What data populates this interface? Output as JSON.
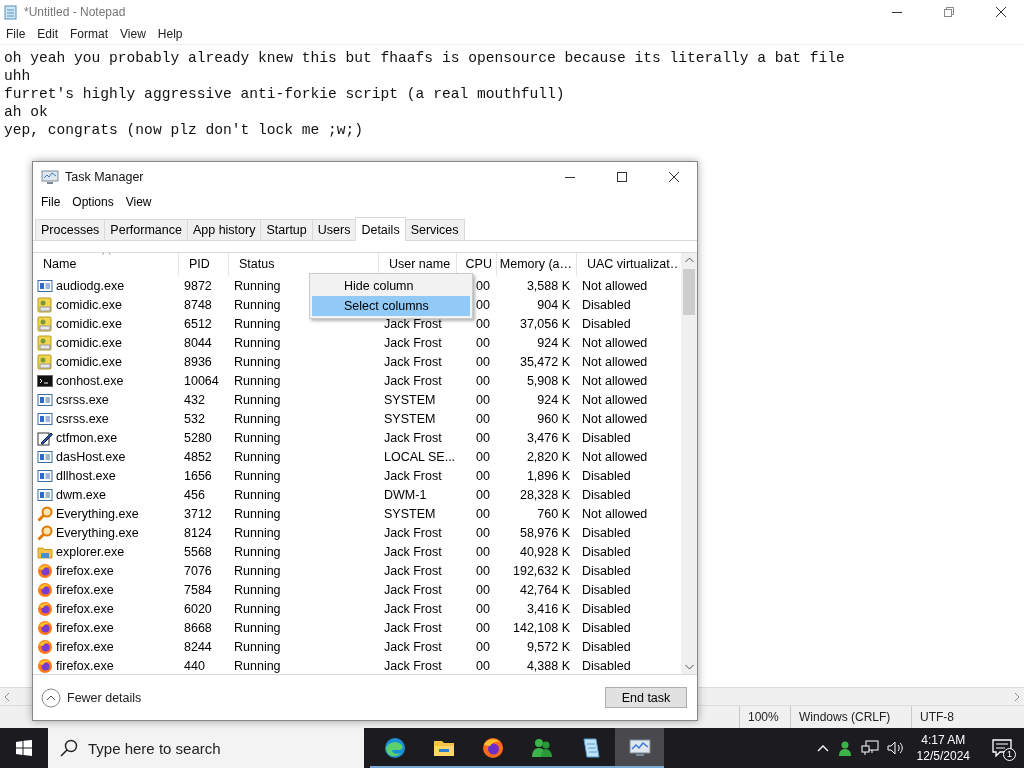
{
  "notepad": {
    "title": "*Untitled - Notepad",
    "menu": [
      "File",
      "Edit",
      "Format",
      "View",
      "Help"
    ],
    "lines": [
      "oh yeah you probably already knew this but fhaafs is opensource because its literally a bat file",
      "uhh",
      "furret's highly aggressive anti-forkie script (a real mouthfull)",
      "ah ok",
      "yep, congrats (now plz don't lock me ;w;)"
    ],
    "status_bar": [
      "100%",
      "Windows (CRLF)",
      "UTF-8"
    ]
  },
  "task_manager": {
    "title": "Task Manager",
    "menu": [
      "File",
      "Options",
      "View"
    ],
    "tabs": [
      {
        "label": "Processes",
        "selected": false
      },
      {
        "label": "Performance",
        "selected": false
      },
      {
        "label": "App history",
        "selected": false
      },
      {
        "label": "Startup",
        "selected": false
      },
      {
        "label": "Users",
        "selected": false
      },
      {
        "label": "Details",
        "selected": true
      },
      {
        "label": "Services",
        "selected": false
      }
    ],
    "columns": [
      "Name",
      "PID",
      "Status",
      "User name",
      "CPU",
      "Memory (a…",
      "UAC virtualizat…"
    ],
    "rows": [
      {
        "kind": "window",
        "name": "audiodg.exe",
        "pid": "9872",
        "status": "Running",
        "cpu": "00",
        "memory": "3,588 K",
        "uac": "Not allowed"
      },
      {
        "kind": "app",
        "name": "comidic.exe",
        "pid": "8748",
        "status": "Running",
        "cpu": "00",
        "memory": "904 K",
        "uac": "Disabled"
      },
      {
        "kind": "app",
        "name": "comidic.exe",
        "pid": "6512",
        "status": "Running",
        "user": "Jack Frost",
        "cpu": "00",
        "memory": "37,056 K",
        "uac": "Disabled"
      },
      {
        "kind": "app",
        "name": "comidic.exe",
        "pid": "8044",
        "status": "Running",
        "user": "Jack Frost",
        "cpu": "00",
        "memory": "924 K",
        "uac": "Not allowed"
      },
      {
        "kind": "app",
        "name": "comidic.exe",
        "pid": "8936",
        "status": "Running",
        "user": "Jack Frost",
        "cpu": "00",
        "memory": "35,472 K",
        "uac": "Not allowed"
      },
      {
        "kind": "console",
        "name": "conhost.exe",
        "pid": "10064",
        "status": "Running",
        "user": "Jack Frost",
        "cpu": "00",
        "memory": "5,908 K",
        "uac": "Not allowed"
      },
      {
        "kind": "window",
        "name": "csrss.exe",
        "pid": "432",
        "status": "Running",
        "user": "SYSTEM",
        "cpu": "00",
        "memory": "924 K",
        "uac": "Not allowed"
      },
      {
        "kind": "window",
        "name": "csrss.exe",
        "pid": "532",
        "status": "Running",
        "user": "SYSTEM",
        "cpu": "00",
        "memory": "960 K",
        "uac": "Not allowed"
      },
      {
        "kind": "pen",
        "name": "ctfmon.exe",
        "pid": "5280",
        "status": "Running",
        "user": "Jack Frost",
        "cpu": "00",
        "memory": "3,476 K",
        "uac": "Disabled"
      },
      {
        "kind": "window",
        "name": "dasHost.exe",
        "pid": "4852",
        "status": "Running",
        "user": "LOCAL SE...",
        "cpu": "00",
        "memory": "2,820 K",
        "uac": "Not allowed"
      },
      {
        "kind": "window",
        "name": "dllhost.exe",
        "pid": "1656",
        "status": "Running",
        "user": "Jack Frost",
        "cpu": "00",
        "memory": "1,896 K",
        "uac": "Disabled"
      },
      {
        "kind": "window",
        "name": "dwm.exe",
        "pid": "456",
        "status": "Running",
        "user": "DWM-1",
        "cpu": "00",
        "memory": "28,328 K",
        "uac": "Disabled"
      },
      {
        "kind": "magnifier",
        "name": "Everything.exe",
        "pid": "3712",
        "status": "Running",
        "user": "SYSTEM",
        "cpu": "00",
        "memory": "760 K",
        "uac": "Not allowed"
      },
      {
        "kind": "magnifier",
        "name": "Everything.exe",
        "pid": "8124",
        "status": "Running",
        "user": "Jack Frost",
        "cpu": "00",
        "memory": "58,976 K",
        "uac": "Disabled"
      },
      {
        "kind": "folder",
        "name": "explorer.exe",
        "pid": "5568",
        "status": "Running",
        "user": "Jack Frost",
        "cpu": "00",
        "memory": "40,928 K",
        "uac": "Disabled"
      },
      {
        "kind": "globe",
        "name": "firefox.exe",
        "pid": "7076",
        "status": "Running",
        "user": "Jack Frost",
        "cpu": "00",
        "memory": "192,632 K",
        "uac": "Disabled"
      },
      {
        "kind": "globe",
        "name": "firefox.exe",
        "pid": "7584",
        "status": "Running",
        "user": "Jack Frost",
        "cpu": "00",
        "memory": "42,764 K",
        "uac": "Disabled"
      },
      {
        "kind": "globe",
        "name": "firefox.exe",
        "pid": "6020",
        "status": "Running",
        "user": "Jack Frost",
        "cpu": "00",
        "memory": "3,416 K",
        "uac": "Disabled"
      },
      {
        "kind": "globe",
        "name": "firefox.exe",
        "pid": "8668",
        "status": "Running",
        "user": "Jack Frost",
        "cpu": "00",
        "memory": "142,108 K",
        "uac": "Disabled"
      },
      {
        "kind": "globe",
        "name": "firefox.exe",
        "pid": "8244",
        "status": "Running",
        "user": "Jack Frost",
        "cpu": "00",
        "memory": "9,572 K",
        "uac": "Disabled"
      },
      {
        "kind": "globe",
        "name": "firefox.exe",
        "pid": "440",
        "status": "Running",
        "user": "Jack Frost",
        "cpu": "00",
        "memory": "4,388 K",
        "uac": "Disabled"
      }
    ],
    "context_menu": [
      {
        "label": "Hide column",
        "selected": false
      },
      {
        "label": "Select columns",
        "selected": true
      }
    ],
    "fewer_details": "Fewer details",
    "end_task": "End task"
  },
  "taskbar": {
    "search_placeholder": "Type here to search",
    "apps": [
      {
        "kind": "edge",
        "selected": false
      },
      {
        "kind": "folder",
        "selected": false
      },
      {
        "kind": "firefox",
        "selected": false
      },
      {
        "kind": "people",
        "selected": false
      },
      {
        "kind": "notepad",
        "selected": false
      },
      {
        "kind": "monitor",
        "selected": true
      }
    ],
    "time": "4:17 AM",
    "date": "12/5/2024",
    "notifications": "1"
  }
}
